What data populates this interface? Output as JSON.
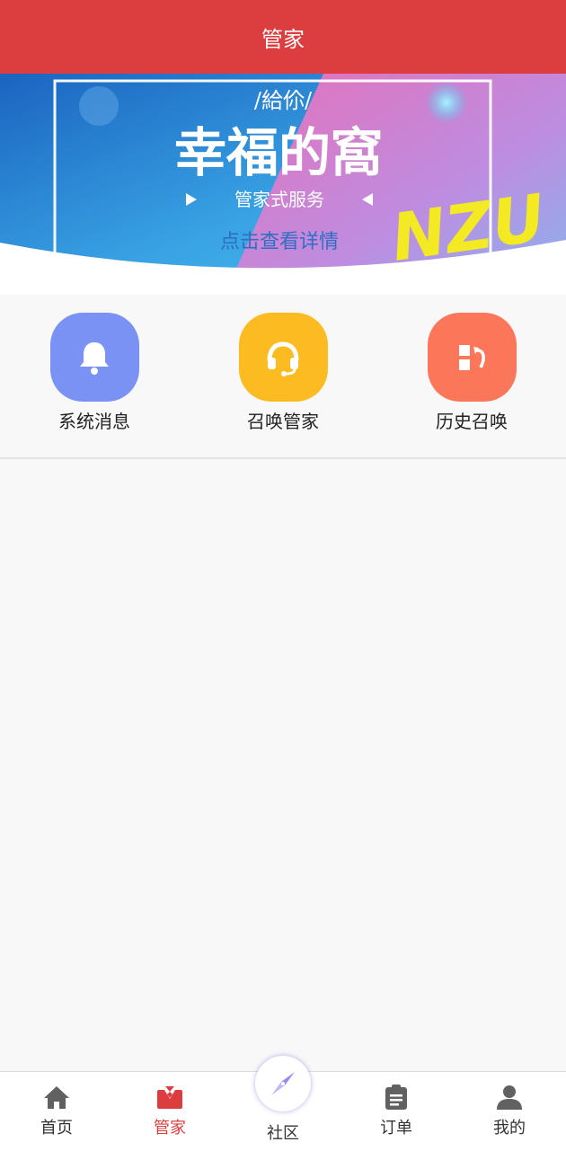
{
  "header": {
    "title": "管家"
  },
  "banner": {
    "small_text": "/給伱/",
    "headline": "幸福的窩",
    "subtitle": "管家式服务",
    "link": "点击查看详情",
    "brand": "NZU"
  },
  "actions": [
    {
      "label": "系统消息",
      "icon": "bell-icon",
      "color": "#7b92f5"
    },
    {
      "label": "召唤管家",
      "icon": "headset-icon",
      "color": "#fdbb22"
    },
    {
      "label": "历史召唤",
      "icon": "history-icon",
      "color": "#fc775a"
    }
  ],
  "tabbar": {
    "items": [
      {
        "label": "首页",
        "icon": "home-icon"
      },
      {
        "label": "管家",
        "icon": "butler-icon",
        "active": true
      },
      {
        "label": "社区",
        "icon": "compass-icon"
      },
      {
        "label": "订单",
        "icon": "clipboard-icon"
      },
      {
        "label": "我的",
        "icon": "user-icon"
      }
    ]
  },
  "colors": {
    "accent": "#dc3d3e",
    "inactive_icon": "#616161"
  }
}
